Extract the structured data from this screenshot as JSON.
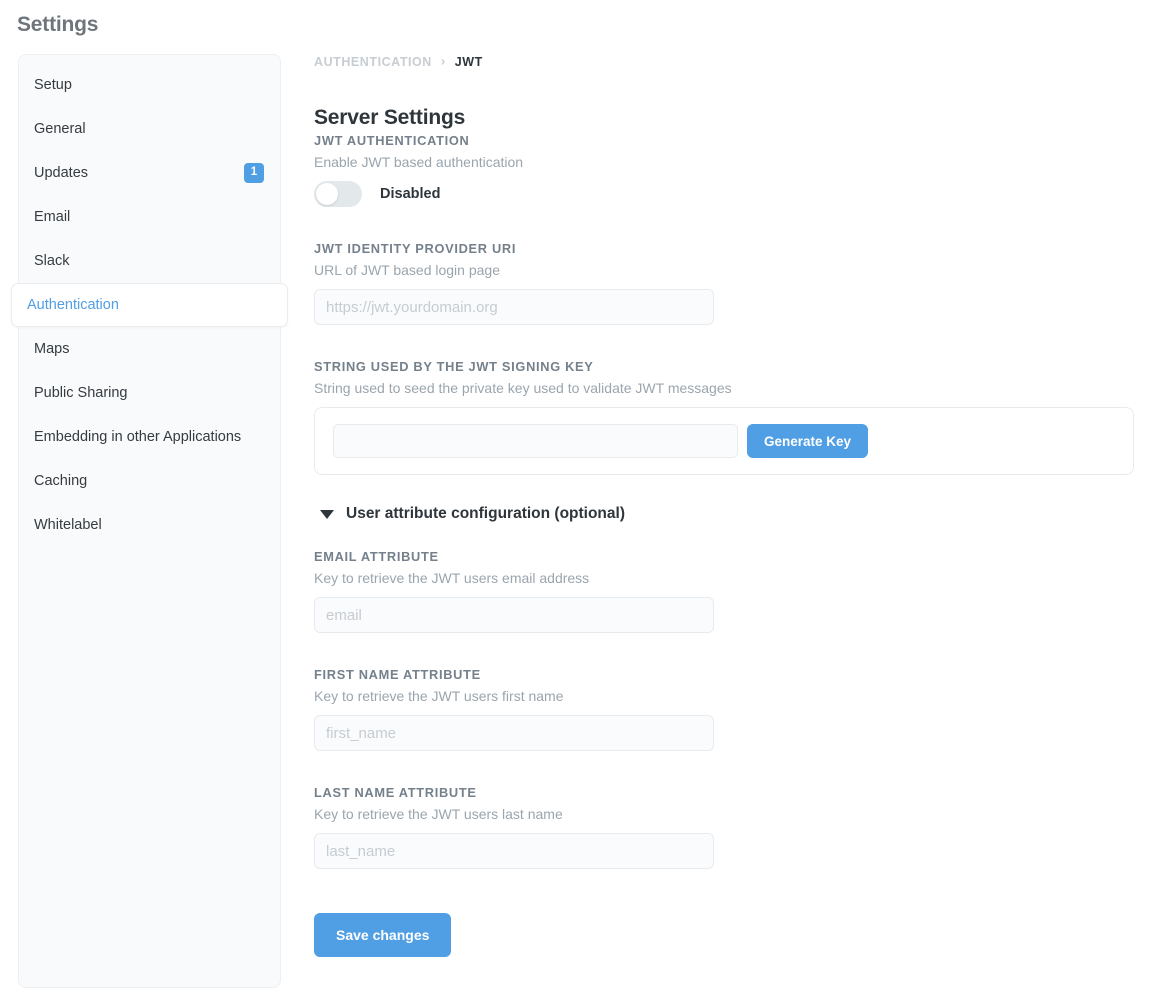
{
  "page": {
    "title": "Settings"
  },
  "sidebar": {
    "items": [
      {
        "label": "Setup",
        "active": false,
        "badge": null
      },
      {
        "label": "General",
        "active": false,
        "badge": null
      },
      {
        "label": "Updates",
        "active": false,
        "badge": "1"
      },
      {
        "label": "Email",
        "active": false,
        "badge": null
      },
      {
        "label": "Slack",
        "active": false,
        "badge": null
      },
      {
        "label": "Authentication",
        "active": true,
        "badge": null
      },
      {
        "label": "Maps",
        "active": false,
        "badge": null
      },
      {
        "label": "Public Sharing",
        "active": false,
        "badge": null
      },
      {
        "label": "Embedding in other Applications",
        "active": false,
        "badge": null
      },
      {
        "label": "Caching",
        "active": false,
        "badge": null
      },
      {
        "label": "Whitelabel",
        "active": false,
        "badge": null
      }
    ]
  },
  "breadcrumb": {
    "parent": "AUTHENTICATION",
    "separator": "›",
    "current": "JWT"
  },
  "main": {
    "heading": "Server Settings",
    "jwt_auth": {
      "label": "JWT AUTHENTICATION",
      "description": "Enable JWT based authentication",
      "toggle_state": "Disabled",
      "toggle_on": false
    },
    "idp_uri": {
      "label": "JWT IDENTITY PROVIDER URI",
      "description": "URL of JWT based login page",
      "value": "",
      "placeholder": "https://jwt.yourdomain.org"
    },
    "signing_key": {
      "label": "STRING USED BY THE JWT SIGNING KEY",
      "description": "String used to seed the private key used to validate JWT messages",
      "value": "",
      "placeholder": "",
      "generate_label": "Generate Key"
    },
    "user_attributes": {
      "title": "User attribute configuration (optional)",
      "expanded": true,
      "fields": [
        {
          "label": "EMAIL ATTRIBUTE",
          "description": "Key to retrieve the JWT users email address",
          "value": "",
          "placeholder": "email"
        },
        {
          "label": "FIRST NAME ATTRIBUTE",
          "description": "Key to retrieve the JWT users first name",
          "value": "",
          "placeholder": "first_name"
        },
        {
          "label": "LAST NAME ATTRIBUTE",
          "description": "Key to retrieve the JWT users last name",
          "value": "",
          "placeholder": "last_name"
        }
      ]
    },
    "save_label": "Save changes"
  },
  "colors": {
    "accent_blue": "#509EE3",
    "text_dark": "#2E353B",
    "text_muted": "#9AA5AE",
    "label_gray": "#74808B",
    "sidebar_bg": "#F9FAFB"
  }
}
